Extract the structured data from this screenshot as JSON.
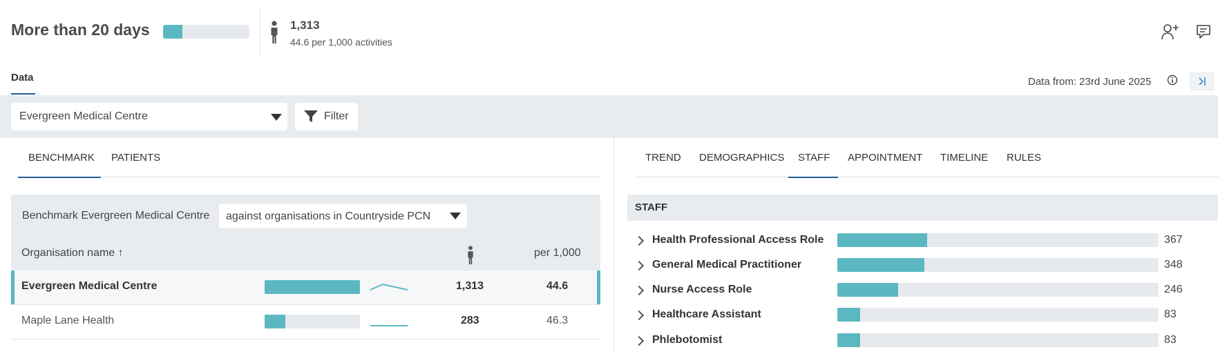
{
  "header": {
    "title": "More than 20 days",
    "progress_fraction": 0.22,
    "count": "1,313",
    "rate": "44.6 per 1,000 activities"
  },
  "nav": {
    "tab_data": "Data",
    "data_from": "Data from: 23rd June 2025"
  },
  "filters": {
    "organisation": "Evergreen Medical Centre",
    "filter_label": "Filter"
  },
  "left_tabs": [
    "BENCHMARK",
    "PATIENTS"
  ],
  "right_tabs": [
    "TREND",
    "DEMOGRAPHICS",
    "STAFF",
    "APPOINTMENT",
    "TIMELINE",
    "RULES"
  ],
  "benchmark": {
    "label": "Benchmark Evergreen Medical Centre",
    "against": "against organisations in Countryside PCN",
    "col_org": "Organisation name ↑",
    "col_rate": "per 1,000",
    "rows": [
      {
        "name": "Evergreen Medical Centre",
        "count": "1,313",
        "rate": "44.6",
        "bar_fraction": 1.0
      },
      {
        "name": "Maple Lane Health",
        "count": "283",
        "rate": "46.3",
        "bar_fraction": 0.22
      }
    ]
  },
  "staff": {
    "header": "STAFF",
    "items": [
      {
        "name": "Health Professional Access Role",
        "value": "367",
        "fraction": 0.28
      },
      {
        "name": "General Medical Practitioner",
        "value": "348",
        "fraction": 0.27
      },
      {
        "name": "Nurse Access Role",
        "value": "246",
        "fraction": 0.19
      },
      {
        "name": "Healthcare Assistant",
        "value": "83",
        "fraction": 0.07
      },
      {
        "name": "Phlebotomist",
        "value": "83",
        "fraction": 0.07
      }
    ]
  },
  "colors": {
    "accent": "#5bb8c2",
    "active_tab": "#1f5a92",
    "panel_bg": "#e8ecef"
  }
}
